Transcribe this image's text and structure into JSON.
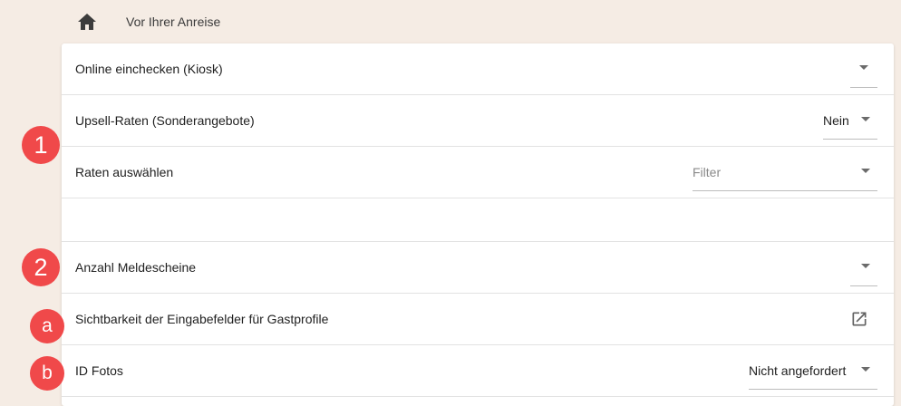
{
  "breadcrumb": {
    "home_icon": "home-icon",
    "label": "Vor Ihrer Anreise"
  },
  "rows": {
    "checkin": {
      "label": "Online einchecken (Kiosk)",
      "value": ""
    },
    "upsell": {
      "label": "Upsell-Raten (Sonderangebote)",
      "value": "Nein"
    },
    "rates": {
      "label": "Raten auswählen",
      "placeholder": "Filter"
    },
    "meldescheine": {
      "label": "Anzahl Meldescheine",
      "value": ""
    },
    "sichtbarkeit": {
      "label": "Sichtbarkeit der Eingabefelder für Gastprofile",
      "icon": "open-in-new-icon"
    },
    "idfotos": {
      "label": "ID Fotos",
      "value": "Nicht angefordert"
    }
  },
  "badges": {
    "one": "1",
    "two": "2",
    "a": "a",
    "b": "b"
  },
  "colors": {
    "background": "#f5ece4",
    "badge": "#f0494a",
    "card": "#ffffff"
  }
}
